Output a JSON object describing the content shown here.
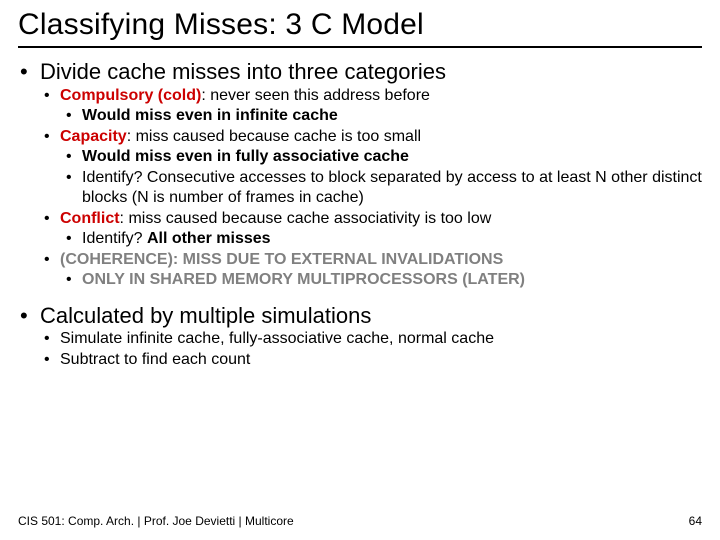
{
  "title": "Classifying Misses: 3 C Model",
  "b1": {
    "divide": "Divide cache misses into three categories",
    "compulsory_label": "Compulsory (cold)",
    "compulsory_rest": ": never seen this address before",
    "compulsory_sub": "Would miss even in infinite cache",
    "capacity_label": "Capacity",
    "capacity_rest": ": miss caused because cache is too small",
    "capacity_sub1": "Would miss even in fully associative cache",
    "capacity_sub2a": "Identify? Consecutive accesses to block separated by access to at least N other distinct blocks (N is number of frames in cache)",
    "conflict_label": "Conflict",
    "conflict_rest": ": miss caused because cache associativity is too low",
    "conflict_sub_a": "Identify? ",
    "conflict_sub_b": "All other misses",
    "coherence_main": "(COHERENCE): MISS DUE TO EXTERNAL INVALIDATIONS",
    "coherence_sub": "ONLY IN SHARED MEMORY MULTIPROCESSORS (LATER)"
  },
  "b2": {
    "calc": "Calculated by multiple simulations",
    "sub1": "Simulate infinite cache, fully-associative cache, normal cache",
    "sub2": "Subtract to find each count"
  },
  "footer": {
    "left": "CIS 501: Comp. Arch.  |  Prof. Joe Devietti  |  Multicore",
    "right": "64"
  }
}
